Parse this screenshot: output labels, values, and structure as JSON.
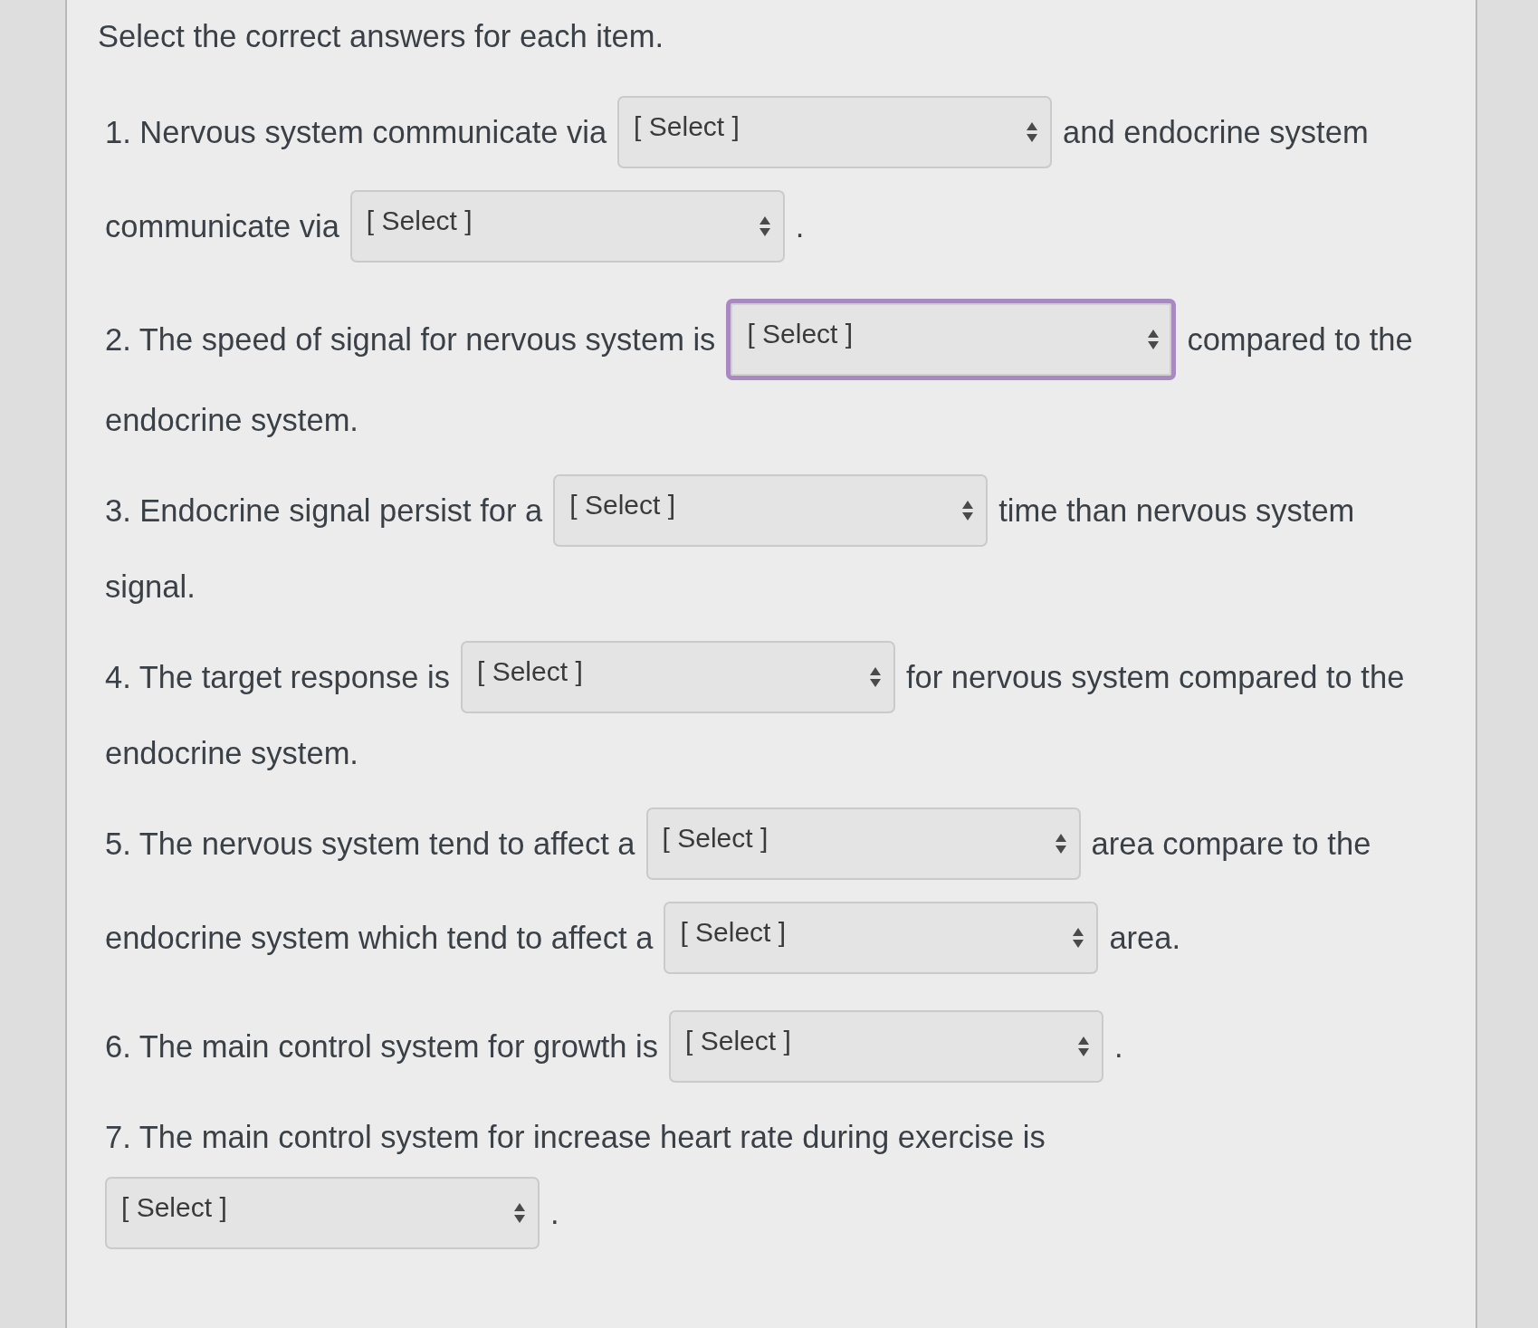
{
  "instruction": "Select the correct answers for each item.",
  "items": [
    {
      "segments": [
        {
          "kind": "text",
          "text": "1. Nervous system communicate via"
        },
        {
          "kind": "select",
          "value": "[ Select ]",
          "focused": false
        },
        {
          "kind": "text",
          "text": "and endocrine system"
        },
        {
          "kind": "text",
          "text": "communicate via"
        },
        {
          "kind": "select",
          "value": "[ Select ]",
          "focused": false
        },
        {
          "kind": "text",
          "text": "."
        }
      ]
    },
    {
      "segments": [
        {
          "kind": "text",
          "text": "2. The speed of signal for nervous system is"
        },
        {
          "kind": "select",
          "value": "[ Select ]",
          "focused": true
        },
        {
          "kind": "text",
          "text": "compared to the"
        },
        {
          "kind": "text",
          "text": "endocrine system."
        }
      ]
    },
    {
      "segments": [
        {
          "kind": "text",
          "text": "3. Endocrine signal persist for a"
        },
        {
          "kind": "select",
          "value": "[ Select ]",
          "focused": false
        },
        {
          "kind": "text",
          "text": "time than nervous system"
        },
        {
          "kind": "text",
          "text": "signal."
        }
      ]
    },
    {
      "segments": [
        {
          "kind": "text",
          "text": "4. The target response is"
        },
        {
          "kind": "select",
          "value": "[ Select ]",
          "focused": false
        },
        {
          "kind": "text",
          "text": "for nervous system compared to the"
        },
        {
          "kind": "text",
          "text": "endocrine system."
        }
      ]
    },
    {
      "segments": [
        {
          "kind": "text",
          "text": "5. The nervous system tend to affect a"
        },
        {
          "kind": "select",
          "value": "[ Select ]",
          "focused": false
        },
        {
          "kind": "text",
          "text": "area compare to the"
        },
        {
          "kind": "text",
          "text": "endocrine system which tend to affect a"
        },
        {
          "kind": "select",
          "value": "[ Select ]",
          "focused": false
        },
        {
          "kind": "text",
          "text": "area."
        }
      ]
    },
    {
      "segments": [
        {
          "kind": "text",
          "text": "6. The main control system for growth is"
        },
        {
          "kind": "select",
          "value": "[ Select ]",
          "focused": false
        },
        {
          "kind": "text",
          "text": "."
        }
      ]
    },
    {
      "segments": [
        {
          "kind": "text",
          "text": "7. The main control system for increase heart rate during exercise is"
        },
        {
          "kind": "select",
          "value": "[ Select ]",
          "focused": false
        },
        {
          "kind": "text",
          "text": "."
        }
      ]
    }
  ]
}
